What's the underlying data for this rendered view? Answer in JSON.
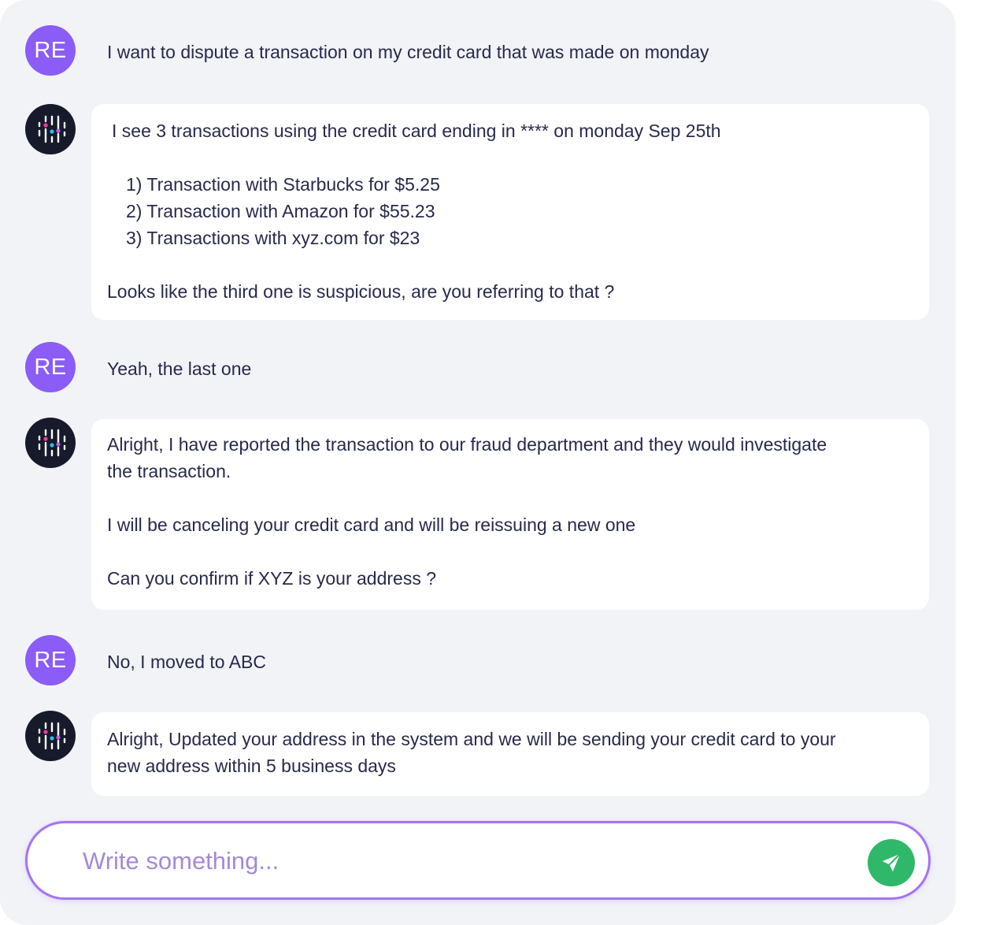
{
  "messages": [
    {
      "sender": "user",
      "avatar": "RE",
      "lines": [
        "I want to dispute a transaction on my credit card that was made on monday"
      ]
    },
    {
      "sender": "bot",
      "avatar_icon": "bot-logo-icon",
      "lines": [
        "I see 3 transactions using the credit card ending in **** on monday Sep 25th",
        "1) Transaction with Starbucks for $5.25",
        "2) Transaction with Amazon for $55.23",
        "3) Transactions with xyz.com for $23",
        "Looks like the third one is suspicious, are you referring to that ?"
      ]
    },
    {
      "sender": "user",
      "avatar": "RE",
      "lines": [
        "Yeah, the last one"
      ]
    },
    {
      "sender": "bot",
      "avatar_icon": "bot-logo-icon",
      "lines": [
        "Alright, I have reported the transaction to our fraud department and they would investigate",
        "the transaction.",
        "I will be canceling your credit card and will be reissuing a new one",
        "Can you confirm if XYZ is your address ?"
      ]
    },
    {
      "sender": "user",
      "avatar": "RE",
      "lines": [
        "No, I moved to ABC"
      ]
    },
    {
      "sender": "bot",
      "avatar_icon": "bot-logo-icon",
      "lines": [
        "Alright, Updated your address in the system and we will be sending your credit card to your",
        "new address within 5 business days"
      ]
    }
  ],
  "composer": {
    "placeholder": "Write something...",
    "value": "",
    "send_icon": "send-icon"
  },
  "colors": {
    "user_avatar": "#8b5cf6",
    "bot_avatar": "#161a2b",
    "send_button": "#2fb86a",
    "composer_border": "#a476ee",
    "panel_background": "#f1f3f7",
    "text": "#272a4a"
  }
}
